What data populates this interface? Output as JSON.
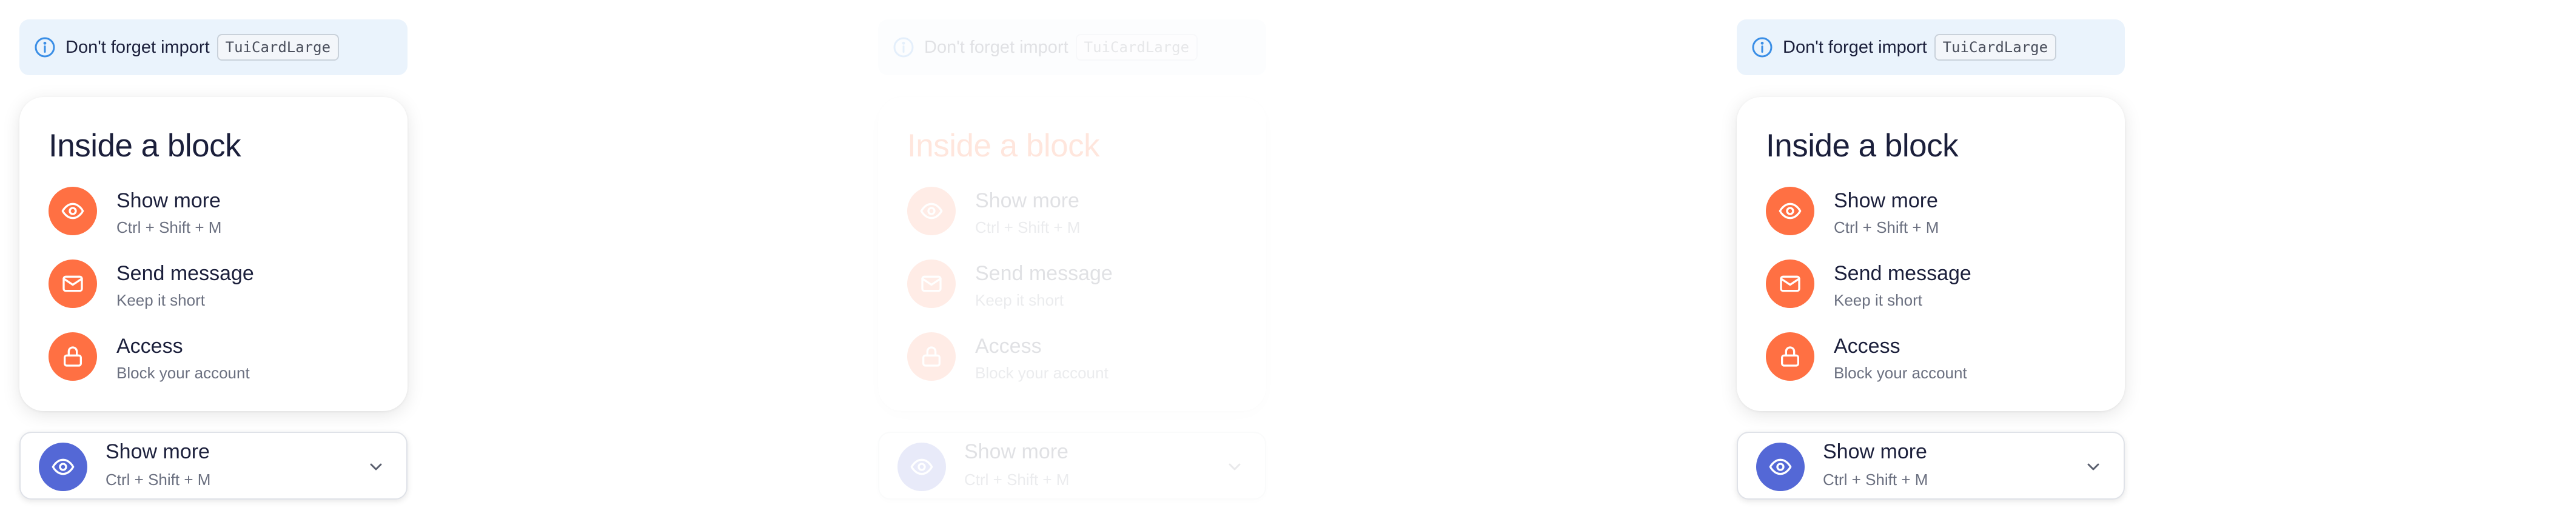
{
  "colors": {
    "accent": "#ff7043",
    "primary": "#5468d6",
    "title_error": "#ff4a00",
    "notice_bg": "#eaf3fc",
    "info": "#3a8ee6"
  },
  "panels": [
    {
      "notice": {
        "text": "Don't forget import",
        "code": "TuiCardLarge",
        "icon": "info-icon"
      },
      "card": {
        "title": "Inside a block",
        "items": [
          {
            "icon": "eye-icon",
            "label": "Show more",
            "sub": "Ctrl + Shift + M"
          },
          {
            "icon": "mail-icon",
            "label": "Send message",
            "sub": "Keep it short"
          },
          {
            "icon": "lock-icon",
            "label": "Access",
            "sub": "Block your account"
          }
        ]
      },
      "select": {
        "icon": "eye-icon",
        "label": "Show more",
        "sub": "Ctrl + Shift + M",
        "chevron": "chevron-down-icon"
      }
    },
    {
      "notice": {
        "text": "Don't forget import",
        "code": "TuiCardLarge",
        "icon": "info-icon"
      },
      "card": {
        "title": "Inside a block",
        "items": [
          {
            "icon": "eye-icon",
            "label": "Show more",
            "sub": "Ctrl + Shift + M"
          },
          {
            "icon": "mail-icon",
            "label": "Send message",
            "sub": "Keep it short"
          },
          {
            "icon": "lock-icon",
            "label": "Access",
            "sub": "Block your account"
          }
        ]
      },
      "select": {
        "icon": "eye-icon",
        "label": "Show more",
        "sub": "Ctrl + Shift + M",
        "chevron": "chevron-down-icon"
      }
    },
    {
      "notice": {
        "text": "Don't forget import",
        "code": "TuiCardLarge",
        "icon": "info-icon"
      },
      "card": {
        "title": "Inside a block",
        "items": [
          {
            "icon": "eye-icon",
            "label": "Show more",
            "sub": "Ctrl + Shift + M"
          },
          {
            "icon": "mail-icon",
            "label": "Send message",
            "sub": "Keep it short"
          },
          {
            "icon": "lock-icon",
            "label": "Access",
            "sub": "Block your account"
          }
        ]
      },
      "select": {
        "icon": "eye-icon",
        "label": "Show more",
        "sub": "Ctrl + Shift + M",
        "chevron": "chevron-down-icon"
      }
    }
  ]
}
